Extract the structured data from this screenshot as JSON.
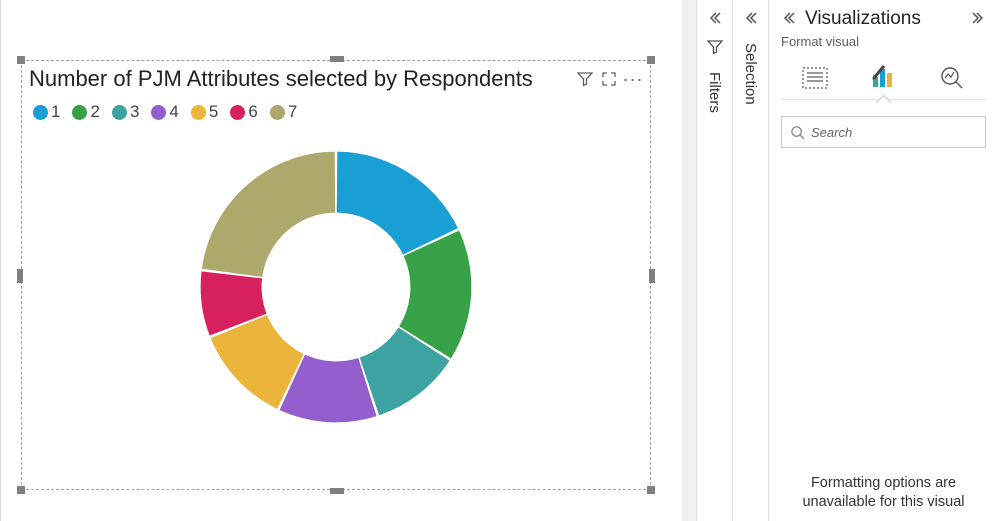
{
  "chart_data": {
    "type": "donut",
    "title": "Number of PJM Attributes selected by Respondents",
    "legend": [
      {
        "label": "1",
        "color": "#199fd3"
      },
      {
        "label": "2",
        "color": "#36a146"
      },
      {
        "label": "3",
        "color": "#3ca3a2"
      },
      {
        "label": "4",
        "color": "#945ecf"
      },
      {
        "label": "5",
        "color": "#ebb43a"
      },
      {
        "label": "6",
        "color": "#d7215e"
      },
      {
        "label": "7",
        "color": "#ada86b"
      }
    ],
    "series": [
      {
        "name": "1",
        "value": 18
      },
      {
        "name": "2",
        "value": 16
      },
      {
        "name": "3",
        "value": 11
      },
      {
        "name": "4",
        "value": 12
      },
      {
        "name": "5",
        "value": 12
      },
      {
        "name": "6",
        "value": 8
      },
      {
        "name": "7",
        "value": 23
      }
    ],
    "inner_radius_pct": 55
  },
  "panels": {
    "filters": "Filters",
    "selection": "Selection"
  },
  "viz": {
    "title": "Visualizations",
    "subtitle": "Format visual",
    "search_placeholder": "Search",
    "message": "Formatting options are unavailable for this visual"
  }
}
